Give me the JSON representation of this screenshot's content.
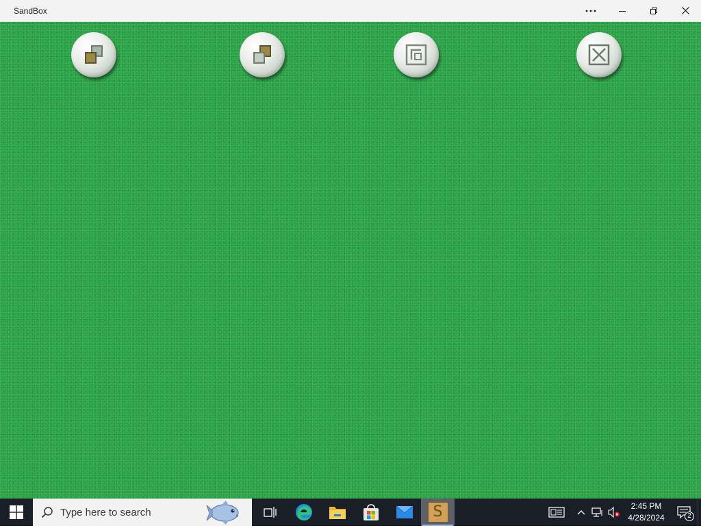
{
  "window": {
    "title": "SandBox",
    "controls": [
      "more-options",
      "minimize",
      "restore",
      "close"
    ]
  },
  "canvas": {
    "background_color": "#2ea84a",
    "buttons": [
      {
        "name": "tile-windows-button",
        "icon": "overlap-squares-front-icon"
      },
      {
        "name": "cascade-windows-button",
        "icon": "overlap-squares-back-icon"
      },
      {
        "name": "restore-board-button",
        "icon": "nested-squares-icon"
      },
      {
        "name": "close-board-button",
        "icon": "x-box-icon"
      }
    ]
  },
  "taskbar": {
    "search_placeholder": "Type here to search",
    "pinned_apps": [
      {
        "name": "task-view",
        "icon": "task-view-icon"
      },
      {
        "name": "edge",
        "icon": "edge-icon"
      },
      {
        "name": "file-explorer",
        "icon": "folder-icon"
      },
      {
        "name": "store",
        "icon": "store-icon"
      },
      {
        "name": "mail",
        "icon": "mail-icon"
      },
      {
        "name": "sandbox",
        "icon": "sandbox-app-icon",
        "letter": "S",
        "active": true
      }
    ],
    "clock": {
      "time": "2:45 PM",
      "date": "4/28/2024"
    },
    "notifications_count": "2",
    "accent_color": "#9bb9e6",
    "taskbar_color": "#1a1e27"
  }
}
